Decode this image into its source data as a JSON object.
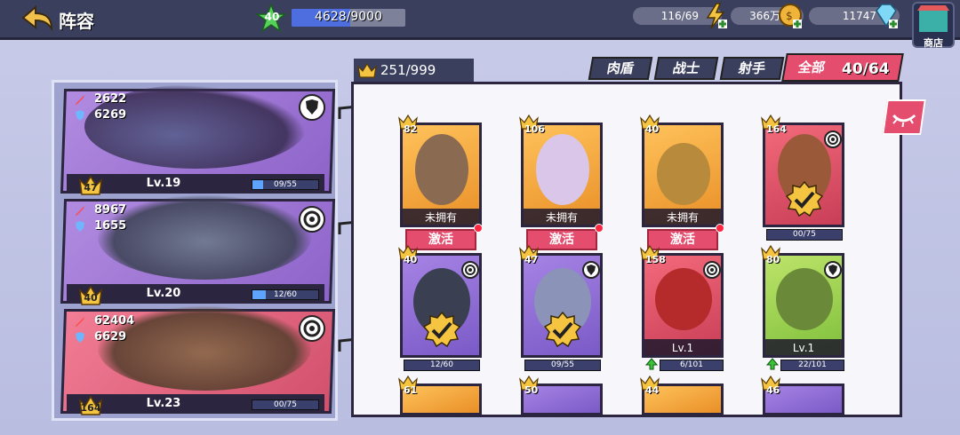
{
  "header": {
    "title": "阵容",
    "player_level": "40",
    "xp": "4628/9000",
    "xp_fraction": 0.514,
    "stamina": "116/69",
    "gold": "366万",
    "gems": "11747",
    "shop_label": "商店"
  },
  "teams": [
    {
      "attack": "2622",
      "defense": "6269",
      "star_level": "47",
      "level": "Lv.19",
      "progress": "09/55",
      "progress_fraction": 0.16,
      "role_icon": "shield-icon",
      "color": "purple"
    },
    {
      "attack": "8967",
      "defense": "1655",
      "star_level": "40",
      "level": "Lv.20",
      "progress": "12/60",
      "progress_fraction": 0.2,
      "role_icon": "target-icon",
      "color": "purple"
    },
    {
      "attack": "62404",
      "defense": "6629",
      "star_level": "164",
      "level": "Lv.23",
      "progress": "00/75",
      "progress_fraction": 0.0,
      "role_icon": "target-icon",
      "color": "red"
    }
  ],
  "collection": {
    "crowns": "251/999",
    "tabs": [
      "肉盾",
      "战士",
      "射手",
      "全部"
    ],
    "active_tab": "全部",
    "count": "40/64"
  },
  "cards": [
    {
      "rank": "82",
      "status": "未拥有",
      "action": "激活",
      "color": "orange"
    },
    {
      "rank": "106",
      "status": "未拥有",
      "action": "激活",
      "color": "orange"
    },
    {
      "rank": "40",
      "status": "未拥有",
      "action": "激活",
      "color": "orange"
    },
    {
      "rank": "164",
      "progress": "00/75",
      "role_icon": "target-icon",
      "color": "red"
    },
    {
      "rank": "40",
      "progress": "12/60",
      "role_icon": "target-icon",
      "color": "purple"
    },
    {
      "rank": "47",
      "progress": "09/55",
      "role_icon": "shield-icon",
      "color": "purple"
    },
    {
      "rank": "158",
      "level": "Lv.1",
      "progress": "6/101",
      "role_icon": "target-icon",
      "color": "red"
    },
    {
      "rank": "80",
      "level": "Lv.1",
      "progress": "22/101",
      "role_icon": "shield-icon",
      "color": "green"
    },
    {
      "rank": "61",
      "color": "orange"
    },
    {
      "rank": "50",
      "color": "purple"
    },
    {
      "rank": "44",
      "color": "orange"
    },
    {
      "rank": "46",
      "color": "purple"
    }
  ]
}
